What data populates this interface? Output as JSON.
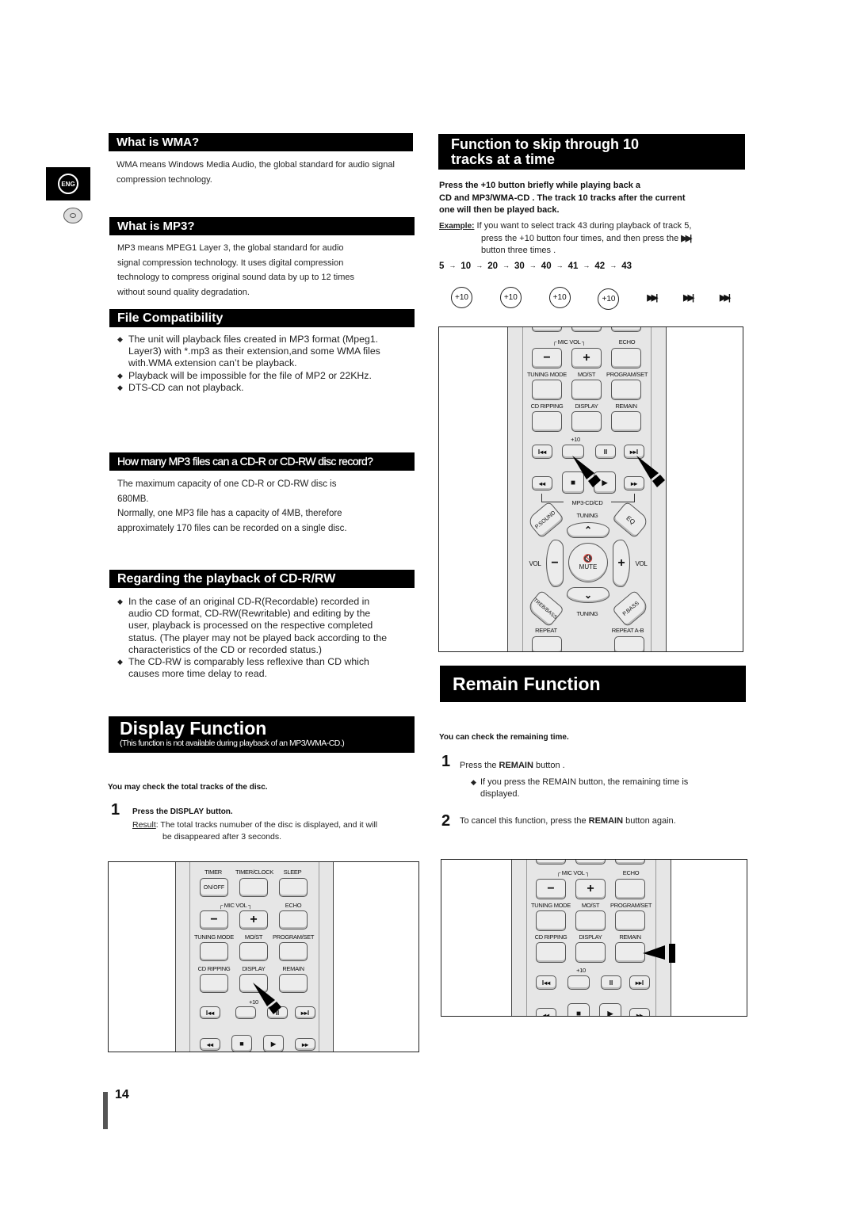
{
  "side": {
    "lang_badge": "ENG",
    "disc_icon": "disc-icon"
  },
  "wma": {
    "title": "What is WMA?",
    "text": "WMA means Windows Media Audio, the global standard for audio signal compression technology."
  },
  "mp3": {
    "title": "What is MP3?",
    "lines": [
      "MP3 means MPEG1 Layer 3, the global standard for audio",
      "signal compression technology. It uses digital compression",
      "technology to compress original sound data by up to 12 times",
      "without sound quality degradation."
    ]
  },
  "compat": {
    "title": "File Compatibility",
    "bullets": [
      "The unit will playback files created in MP3 format (Mpeg1. Layer3) with *.mp3 as their extension,and some WMA files with.WMA extension can’t be playback.",
      "Playback will be impossible for the file of MP2 or 22KHz.",
      "DTS-CD can not playback."
    ]
  },
  "capacity": {
    "title": "How many MP3 files can a CD-R or CD-RW disc record?",
    "lines": [
      "The maximum capacity of one CD-R or CD-RW disc is",
      "680MB.",
      "Normally, one MP3 file has a capacity of 4MB, therefore",
      "approximately 170 files can be recorded on a single disc."
    ]
  },
  "cdrw": {
    "title": "Regarding the playback of CD-R/RW",
    "bullets": [
      "In the case of an original CD-R(Recordable) recorded in audio CD format, CD-RW(Rewritable) and editing by the user, playback is processed on the respective completed status. (The player may not be played back according to the characteristics of the CD or recorded status.)",
      "The CD-RW is comparably less reflexive than CD which causes more time delay to read."
    ]
  },
  "display": {
    "title": "Display Function",
    "subtitle": "(This function is not available during playback of an MP3/WMA-CD.)",
    "intro": "You may check the total tracks of the disc.",
    "step_num": "1",
    "step_text": "Press the DISPLAY button.",
    "result_label": "Result",
    "result_text": ": The total tracks numuber of the disc is displayed, and it will",
    "result_text2": "be disappeared after 3 seconds."
  },
  "skip": {
    "title_line1": "Function to skip through 10",
    "title_line2": "tracks at a time",
    "intro_lines": [
      "Press the +10 button briefly while playing back a",
      "CD and MP3/WMA-CD . The track 10 tracks after the current",
      "one will then be played back."
    ],
    "example_label": "Example:",
    "example_lines": [
      "If you want to select track 43 during playback of track 5,",
      "press the +10 button four times, and then press the",
      "button three times ."
    ],
    "example_bold": "+10",
    "sequence": [
      "5",
      "10",
      "20",
      "30",
      "40",
      "41",
      "42",
      "43"
    ],
    "sequence_arrow": "→",
    "presses": [
      "+10",
      "+10",
      "+10",
      "+10",
      "skip-next",
      "skip-next",
      "skip-next"
    ]
  },
  "remain": {
    "title": "Remain Function",
    "intro": "You can check the remaining time.",
    "step1_num": "1",
    "step1_pre": "Press the ",
    "step1_bold": "REMAIN",
    "step1_post": " button .",
    "step1_note": "If you press the REMAIN button, the remaining time is displayed.",
    "step2_num": "2",
    "step2_pre": "To cancel this function, press the ",
    "step2_bold": "REMAIN",
    "step2_post": " button again."
  },
  "remote_labels": {
    "mic_vol": "┌ MIC VOL ┐",
    "echo": "ECHO",
    "tuning_mode": "TUNING MODE",
    "mo_st": "MO/ST",
    "program_set": "PROGRAM/SET",
    "cd_ripping": "CD RIPPING",
    "display": "DISPLAY",
    "remain": "REMAIN",
    "plus10": "+10",
    "mp3_cd": "MP3-CD/CD",
    "tuning": "TUNING",
    "psound": "P.SOUND",
    "eq": "EQ",
    "vol": "VOL",
    "mute": "MUTE",
    "treb_bass": "TREB/BASS",
    "pbass": "P.BASS",
    "repeat": "REPEAT",
    "repeat_ab": "REPEAT A-B",
    "timer": "TIMER",
    "timer_clock": "TIMER/CLOCK",
    "sleep": "SLEEP",
    "on_off": "ON/OFF",
    "minus": "−",
    "plus": "+",
    "prev": "I◂◂",
    "pause": "II",
    "next": "▸▸I",
    "rew": "◂◂",
    "stop": "■",
    "play": "▶",
    "ff": "▸▸"
  },
  "page_number": "14"
}
